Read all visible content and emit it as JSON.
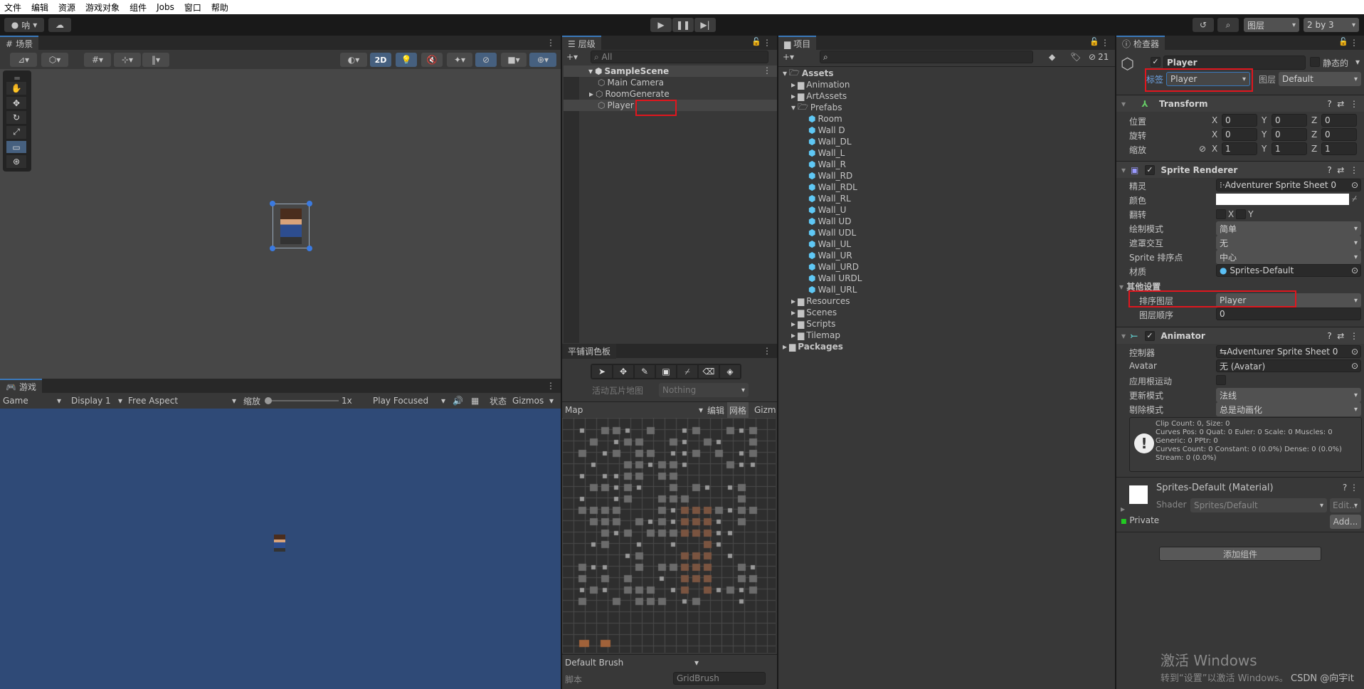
{
  "menu": [
    "文件",
    "编辑",
    "资源",
    "游戏对象",
    "组件",
    "Jobs",
    "窗口",
    "帮助"
  ],
  "toolbar": {
    "account": "呐",
    "account_icon": "account-icon",
    "cloud_icon": "cloud-icon",
    "play_icon": "play-icon",
    "pause_icon": "pause-icon",
    "step_icon": "step-icon",
    "history_icon": "history-icon",
    "search_icon": "search-icon",
    "layers": "图层",
    "layout": "2 by 3"
  },
  "scene": {
    "tab": "场景",
    "toggle_2d": "2D",
    "tools": [
      "hand",
      "move",
      "rotate",
      "scale",
      "rect",
      "transform"
    ]
  },
  "game": {
    "tab": "游戏",
    "display_mode": "Game",
    "display": "Display 1",
    "aspect": "Free Aspect",
    "scale_label": "缩放",
    "scale_value": "1x",
    "scale_fraction": 0,
    "play_mode": "Play Focused",
    "stats": "状态",
    "gizmos": "Gizmos",
    "background": "#2f4a77"
  },
  "hierarchy": {
    "tab": "层级",
    "search_placeholder": "All",
    "scene": "SampleScene",
    "items": [
      {
        "label": "Main Camera",
        "expandable": false
      },
      {
        "label": "RoomGenerate",
        "expandable": true
      },
      {
        "label": "Player",
        "expandable": false,
        "selected": true
      }
    ]
  },
  "tile_palette": {
    "tab": "平铺调色板",
    "active_tilemap_label": "活动瓦片地图",
    "active_tilemap": "Nothing",
    "palette": "Map",
    "edit": "编辑",
    "grid": "网格",
    "gizmos": "Gizm",
    "brush": "Default Brush",
    "script_label": "脚本",
    "script_value": "GridBrush"
  },
  "project": {
    "tab": "项目",
    "hidden_count": "21",
    "root": "Assets",
    "folders_before": [
      "Animation",
      "ArtAssets"
    ],
    "open_folder": "Prefabs",
    "prefabs": [
      "Room",
      "Wall D",
      "Wall_DL",
      "Wall_L",
      "Wall_R",
      "Wall_RD",
      "Wall_RDL",
      "Wall_RL",
      "Wall_U",
      "Wall UD",
      "Wall UDL",
      "Wall_UL",
      "Wall_UR",
      "Wall_URD",
      "Wall URDL",
      "Wall_URL"
    ],
    "folders_after": [
      "Resources",
      "Scenes",
      "Scripts",
      "Tilemap"
    ],
    "packages": "Packages"
  },
  "inspector": {
    "tab": "检查器",
    "name": "Player",
    "static_label": "静态的",
    "tag_label": "标签",
    "tag": "Player",
    "layer_label": "图层",
    "layer": "Default",
    "transform": {
      "title": "Transform",
      "rows": [
        {
          "label": "位置",
          "x": "0",
          "y": "0",
          "z": "0"
        },
        {
          "label": "旋转",
          "x": "0",
          "y": "0",
          "z": "0"
        },
        {
          "label": "缩放",
          "x": "1",
          "y": "1",
          "z": "1"
        }
      ]
    },
    "sprite_renderer": {
      "title": "Sprite Renderer",
      "sprite_label": "精灵",
      "sprite": "Adventurer Sprite Sheet 0",
      "color_label": "颜色",
      "color": "#ffffff",
      "flip_label": "翻转",
      "flip_x": "X",
      "flip_y": "Y",
      "draw_mode_label": "绘制模式",
      "draw_mode": "简单",
      "mask_label": "遮罩交互",
      "mask": "无",
      "sort_point_label": "Sprite 排序点",
      "sort_point": "中心",
      "material_label": "材质",
      "material": "Sprites-Default",
      "additional": "其他设置",
      "sorting_layer_label": "排序图层",
      "sorting_layer": "Player",
      "order_label": "图层顺序",
      "order": "0"
    },
    "animator": {
      "title": "Animator",
      "controller_label": "控制器",
      "controller": "Adventurer Sprite Sheet 0",
      "avatar_label": "Avatar",
      "avatar": "无 (Avatar)",
      "root_motion_label": "应用根运动",
      "update_label": "更新模式",
      "update": "法线",
      "culling_label": "剔除模式",
      "culling": "总是动画化",
      "info": [
        "Clip Count: 0, Size: 0",
        "Curves Pos: 0 Quat: 0 Euler: 0 Scale: 0 Muscles: 0 Generic: 0 PPtr: 0",
        "Curves Count: 0 Constant: 0 (0.0%) Dense: 0 (0.0%) Stream: 0 (0.0%)"
      ]
    },
    "material": {
      "title": "Sprites-Default (Material)",
      "shader_label": "Shader",
      "shader": "Sprites/Default",
      "edit": "Edit...",
      "private": "Private",
      "add": "Add..."
    },
    "add_component": "添加组件"
  },
  "watermark": {
    "line1": "激活 Windows",
    "line2": "转到“设置”以激活 Windows。",
    "csdn": "CSDN @向宇it"
  },
  "colors": {
    "highlight": "#e0161e",
    "accent": "#3a79bb"
  }
}
